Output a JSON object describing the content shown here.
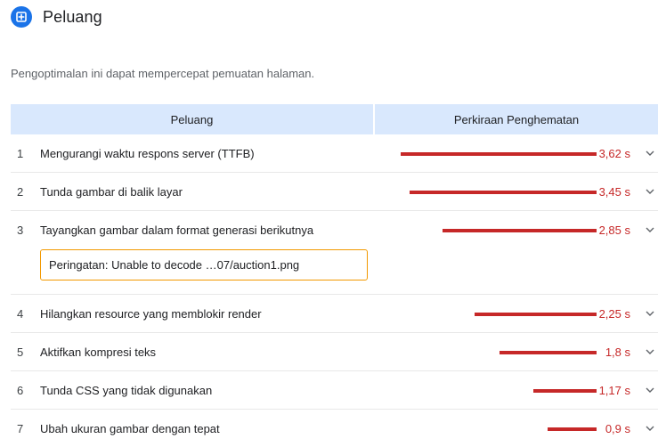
{
  "header": {
    "icon": "opportunity-icon",
    "title": "Peluang",
    "accent_color": "#1a73e8"
  },
  "description": "Pengoptimalan ini dapat mempercepat pemuatan halaman.",
  "table": {
    "headers": {
      "opportunity": "Peluang",
      "savings": "Perkiraan Penghematan"
    },
    "header_bg": "#d9e8fd",
    "bar_color": "#c62828",
    "max_savings_s": 3.62,
    "rows": [
      {
        "num": "1",
        "title": "Mengurangi waktu respons server (TTFB)",
        "value": "3,62 s",
        "savings_s": 3.62
      },
      {
        "num": "2",
        "title": "Tunda gambar di balik layar",
        "value": "3,45 s",
        "savings_s": 3.45
      },
      {
        "num": "3",
        "title": "Tayangkan gambar dalam format generasi berikutnya",
        "value": "2,85 s",
        "savings_s": 2.85,
        "warning": "Peringatan: Unable to decode …07/auction1.png"
      },
      {
        "num": "4",
        "title": "Hilangkan resource yang memblokir render",
        "value": "2,25 s",
        "savings_s": 2.25
      },
      {
        "num": "5",
        "title": "Aktifkan kompresi teks",
        "value": "1,8 s",
        "savings_s": 1.8
      },
      {
        "num": "6",
        "title": "Tunda CSS yang tidak digunakan",
        "value": "1,17 s",
        "savings_s": 1.17
      },
      {
        "num": "7",
        "title": "Ubah ukuran gambar dengan tepat",
        "value": "0,9 s",
        "savings_s": 0.9
      }
    ]
  }
}
